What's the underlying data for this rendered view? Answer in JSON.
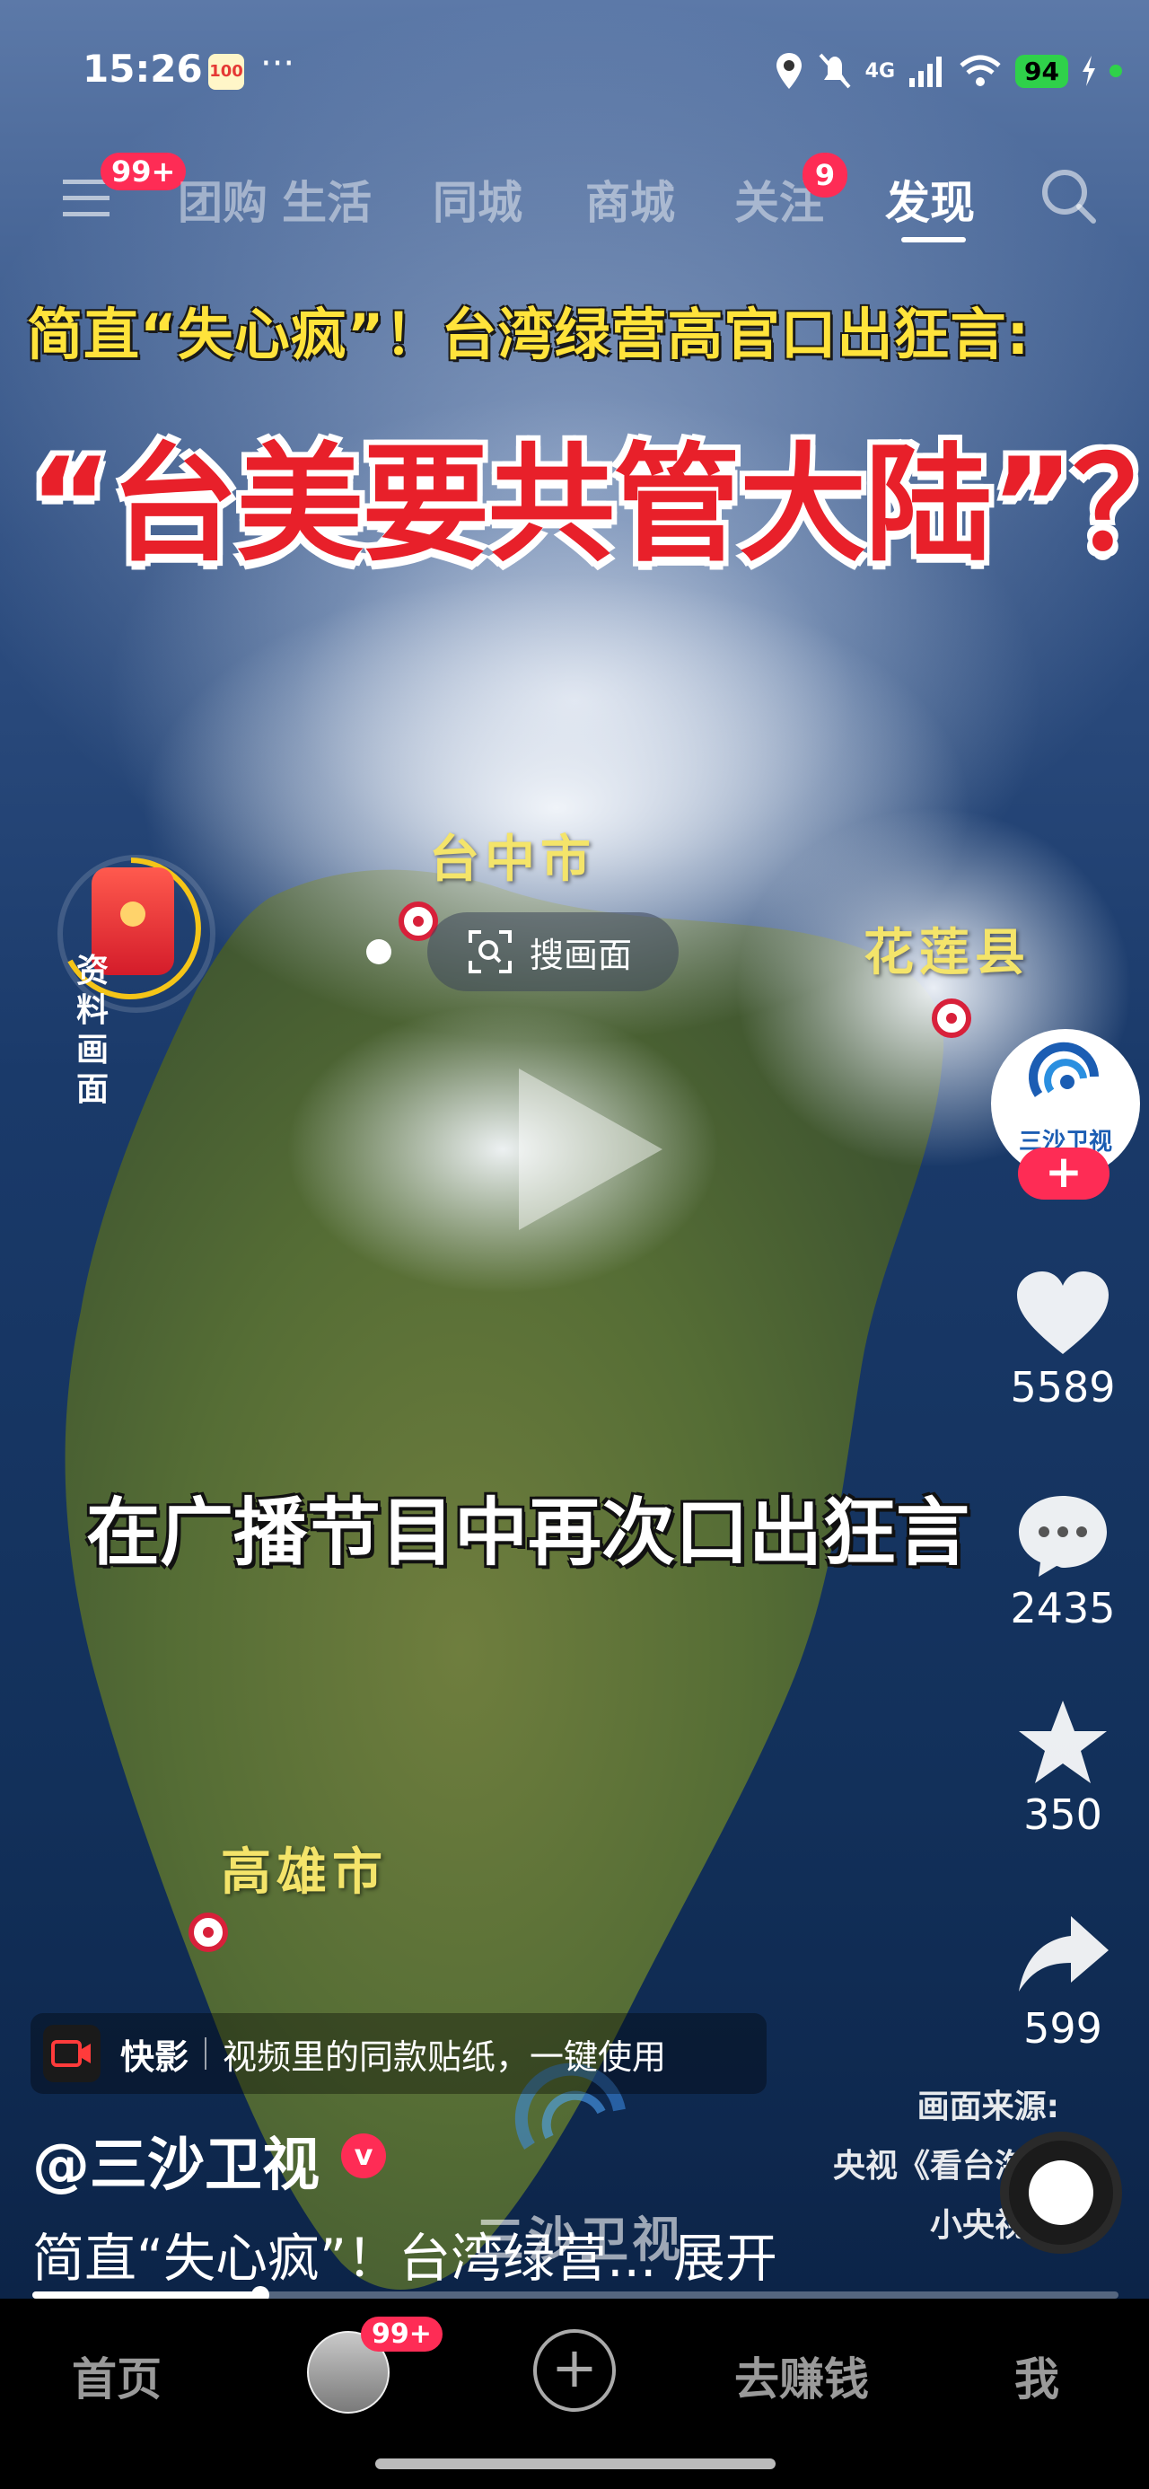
{
  "status_bar": {
    "time": "15:26",
    "network": "4G",
    "battery": "94"
  },
  "top_tabs": {
    "menu_badge": "99+",
    "tabs": [
      "团购",
      "生活",
      "同城",
      "商城",
      "关注",
      "发现"
    ],
    "follow_badge": "9",
    "active_tab": "发现"
  },
  "video": {
    "headline_line1": "简直“失心疯”！台湾绿营高官口出狂言:",
    "headline_line2": "“台美要共管大陆”？",
    "city_labels": [
      "台中市",
      "花莲县",
      "高雄市"
    ],
    "search_pill_label": "搜画面",
    "caption": "在广播节目中再次口出狂言",
    "side_label": "资料画面",
    "source_label": "画面来源:",
    "source_line1": "央视《看台海》",
    "source_line2": "小央视频",
    "watermark_text": "三沙卫视",
    "progress_fraction": 0.21
  },
  "right_actions": {
    "channel_logo_text": "三沙卫视",
    "likes": "5589",
    "comments": "2435",
    "favorites": "350",
    "shares": "599"
  },
  "info": {
    "sticker_app": "快影",
    "sticker_desc": "视频里的同款贴纸，一键使用",
    "author": "@三沙卫视",
    "verified": "v",
    "description": "简直“失心疯”！台湾绿营... 展开"
  },
  "bottom_nav": {
    "home": "首页",
    "avatar_badge": "99+",
    "earn": "去赚钱",
    "me": "我"
  },
  "colors": {
    "accent": "#fe2c55",
    "headline_yellow": "#ffe33b",
    "headline_red": "#e8202a"
  }
}
